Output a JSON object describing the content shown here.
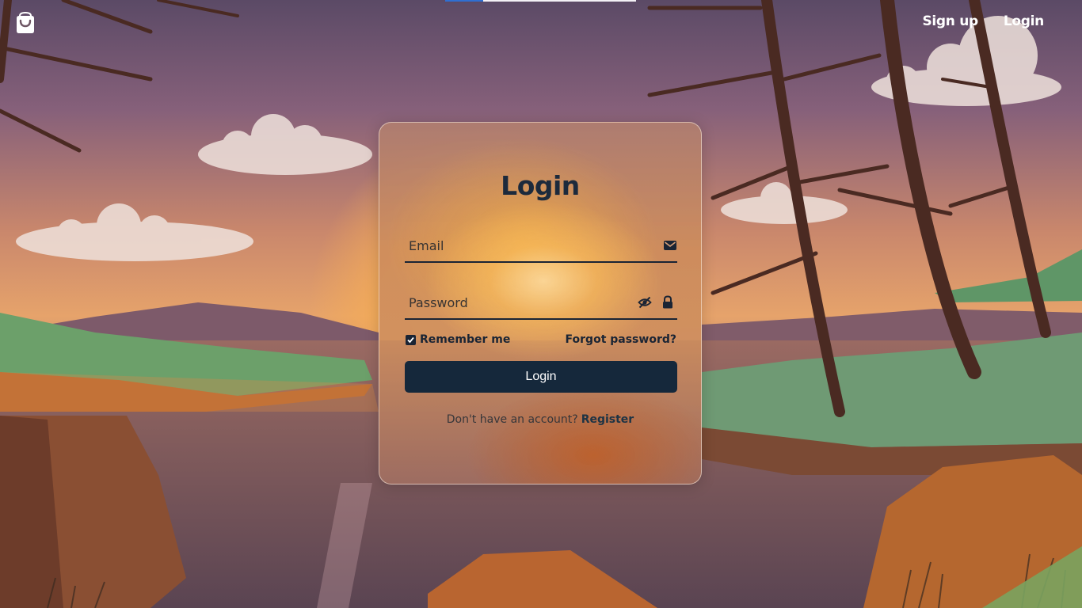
{
  "header": {
    "logo_icon": "shopping-bag-icon",
    "nav": {
      "signup_label": "Sign up",
      "login_label": "Login"
    }
  },
  "loading_bar": {
    "progress": 0.2,
    "colors": {
      "track": "#f3f1f6",
      "fill": "#2f6fd1"
    }
  },
  "login_form": {
    "title": "Login",
    "email": {
      "placeholder": "Email",
      "value": "",
      "icon": "envelope-icon"
    },
    "password": {
      "placeholder": "Password",
      "value": "",
      "toggle_icon": "eye-slash-icon",
      "icon": "lock-icon"
    },
    "remember": {
      "label": "Remember me",
      "checked": true
    },
    "forgot_label": "Forgot password?",
    "submit_label": "Login",
    "register_prompt": "Don't have an account?",
    "register_link": "Register"
  },
  "theme": {
    "primary": "#15283b",
    "text_dark": "#1a2434",
    "white": "#ffffff"
  }
}
